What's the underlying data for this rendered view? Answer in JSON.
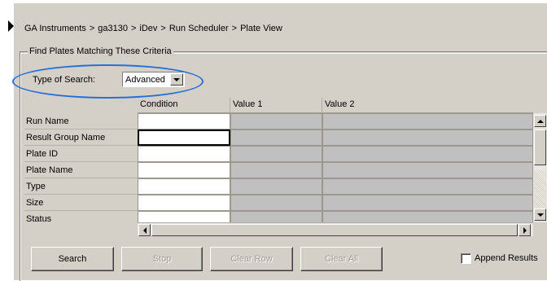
{
  "breadcrumb": [
    "GA Instruments",
    "ga3130",
    "iDev",
    "Run Scheduler",
    "Plate View"
  ],
  "breadcrumb_separator": ">",
  "criteria": {
    "legend": "Find Plates Matching These Criteria",
    "type_label": "Type of Search:",
    "type_value": "Advanced"
  },
  "table": {
    "columns": [
      "Condition",
      "Value 1",
      "Value 2"
    ],
    "rows": [
      "Run Name",
      "Result Group Name",
      "Plate ID",
      "Plate Name",
      "Type",
      "Size",
      "Status"
    ],
    "active_row": "Result Group Name"
  },
  "buttons": {
    "search": "Search",
    "stop": "Stop",
    "clear_row": "Clear Row",
    "clear_all": "Clear All"
  },
  "append_results": {
    "label": "Append Results",
    "checked": false
  },
  "colors": {
    "panel": "#d4d0c8",
    "highlight_oval": "#2a6fd6",
    "disabled_cell": "#c0c0c0"
  }
}
